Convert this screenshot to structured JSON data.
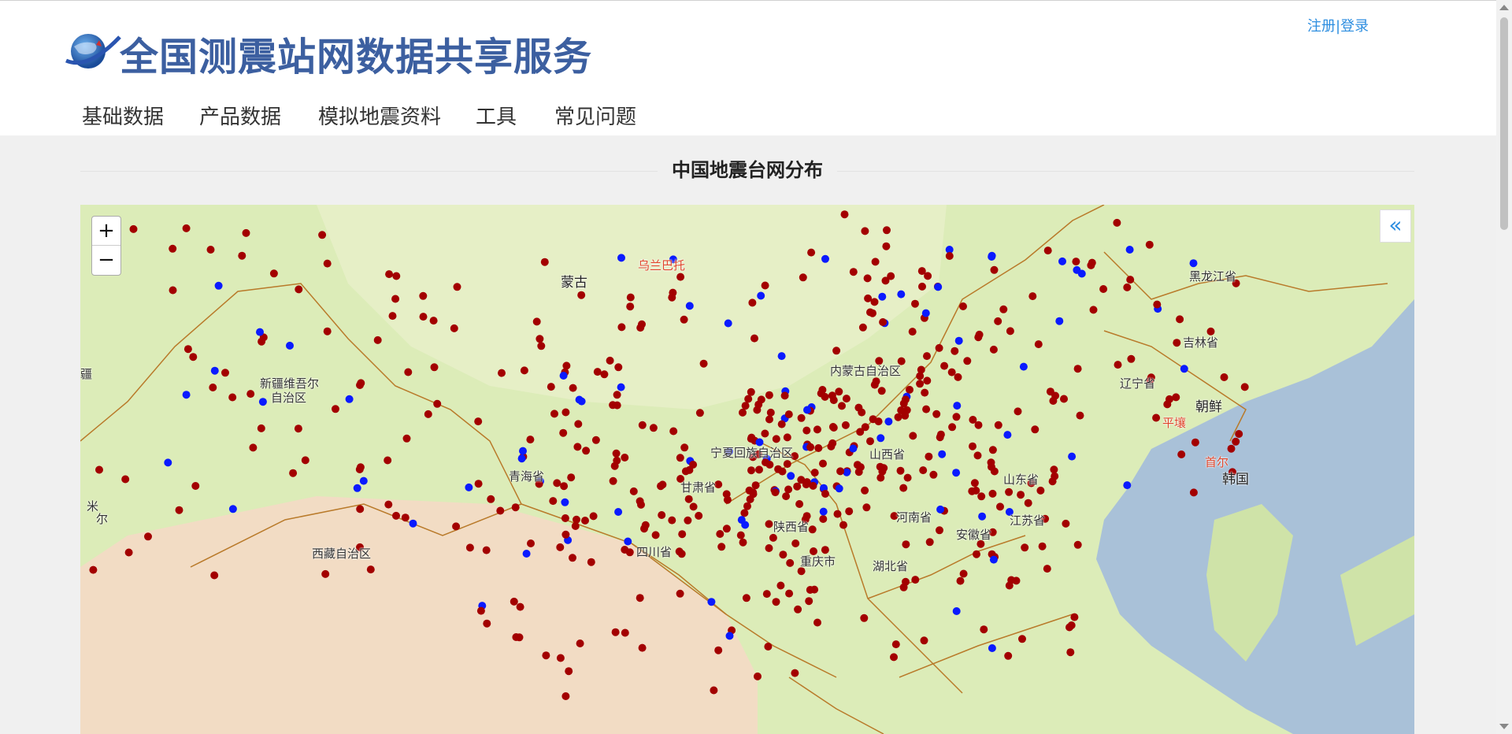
{
  "header": {
    "title": "全国测震站网数据共享服务",
    "register_link": "注册",
    "login_link": "|登录"
  },
  "nav": {
    "items": [
      {
        "label": "基础数据"
      },
      {
        "label": "产品数据"
      },
      {
        "label": "模拟地震资料"
      },
      {
        "label": "工具"
      },
      {
        "label": "常见问题"
      }
    ]
  },
  "main": {
    "section_title": "中国地震台网分布"
  },
  "map": {
    "zoom_in": "+",
    "zoom_out": "−",
    "collapse_icon": "«",
    "labels": [
      {
        "text": "蒙古"
      },
      {
        "text": "乌兰巴托"
      },
      {
        "text": "黑龙江省"
      },
      {
        "text": "吉林省"
      },
      {
        "text": "辽宁省"
      },
      {
        "text": "朝鲜"
      },
      {
        "text": "平壤"
      },
      {
        "text": "首尔"
      },
      {
        "text": "韩国"
      },
      {
        "text": "内蒙古自治区"
      },
      {
        "text": "新疆维吾尔"
      },
      {
        "text": "自治区"
      },
      {
        "text": "青海省"
      },
      {
        "text": "甘肃省"
      },
      {
        "text": "宁夏回族自治区"
      },
      {
        "text": "山西省"
      },
      {
        "text": "山东省"
      },
      {
        "text": "河南省"
      },
      {
        "text": "陕西省"
      },
      {
        "text": "江苏省"
      },
      {
        "text": "安徽省"
      },
      {
        "text": "湖北省"
      },
      {
        "text": "重庆市"
      },
      {
        "text": "四川省"
      },
      {
        "text": "西藏自治区"
      },
      {
        "text": "尔"
      },
      {
        "text": "米"
      },
      {
        "text": "疆"
      }
    ],
    "colors": {
      "station_red": "#a30000",
      "station_blue": "#0a1aff",
      "sea": "#a9c1d8",
      "land_green": "#dcecb8",
      "desert": "#f2dcc4",
      "border": "#b97a2a"
    }
  }
}
